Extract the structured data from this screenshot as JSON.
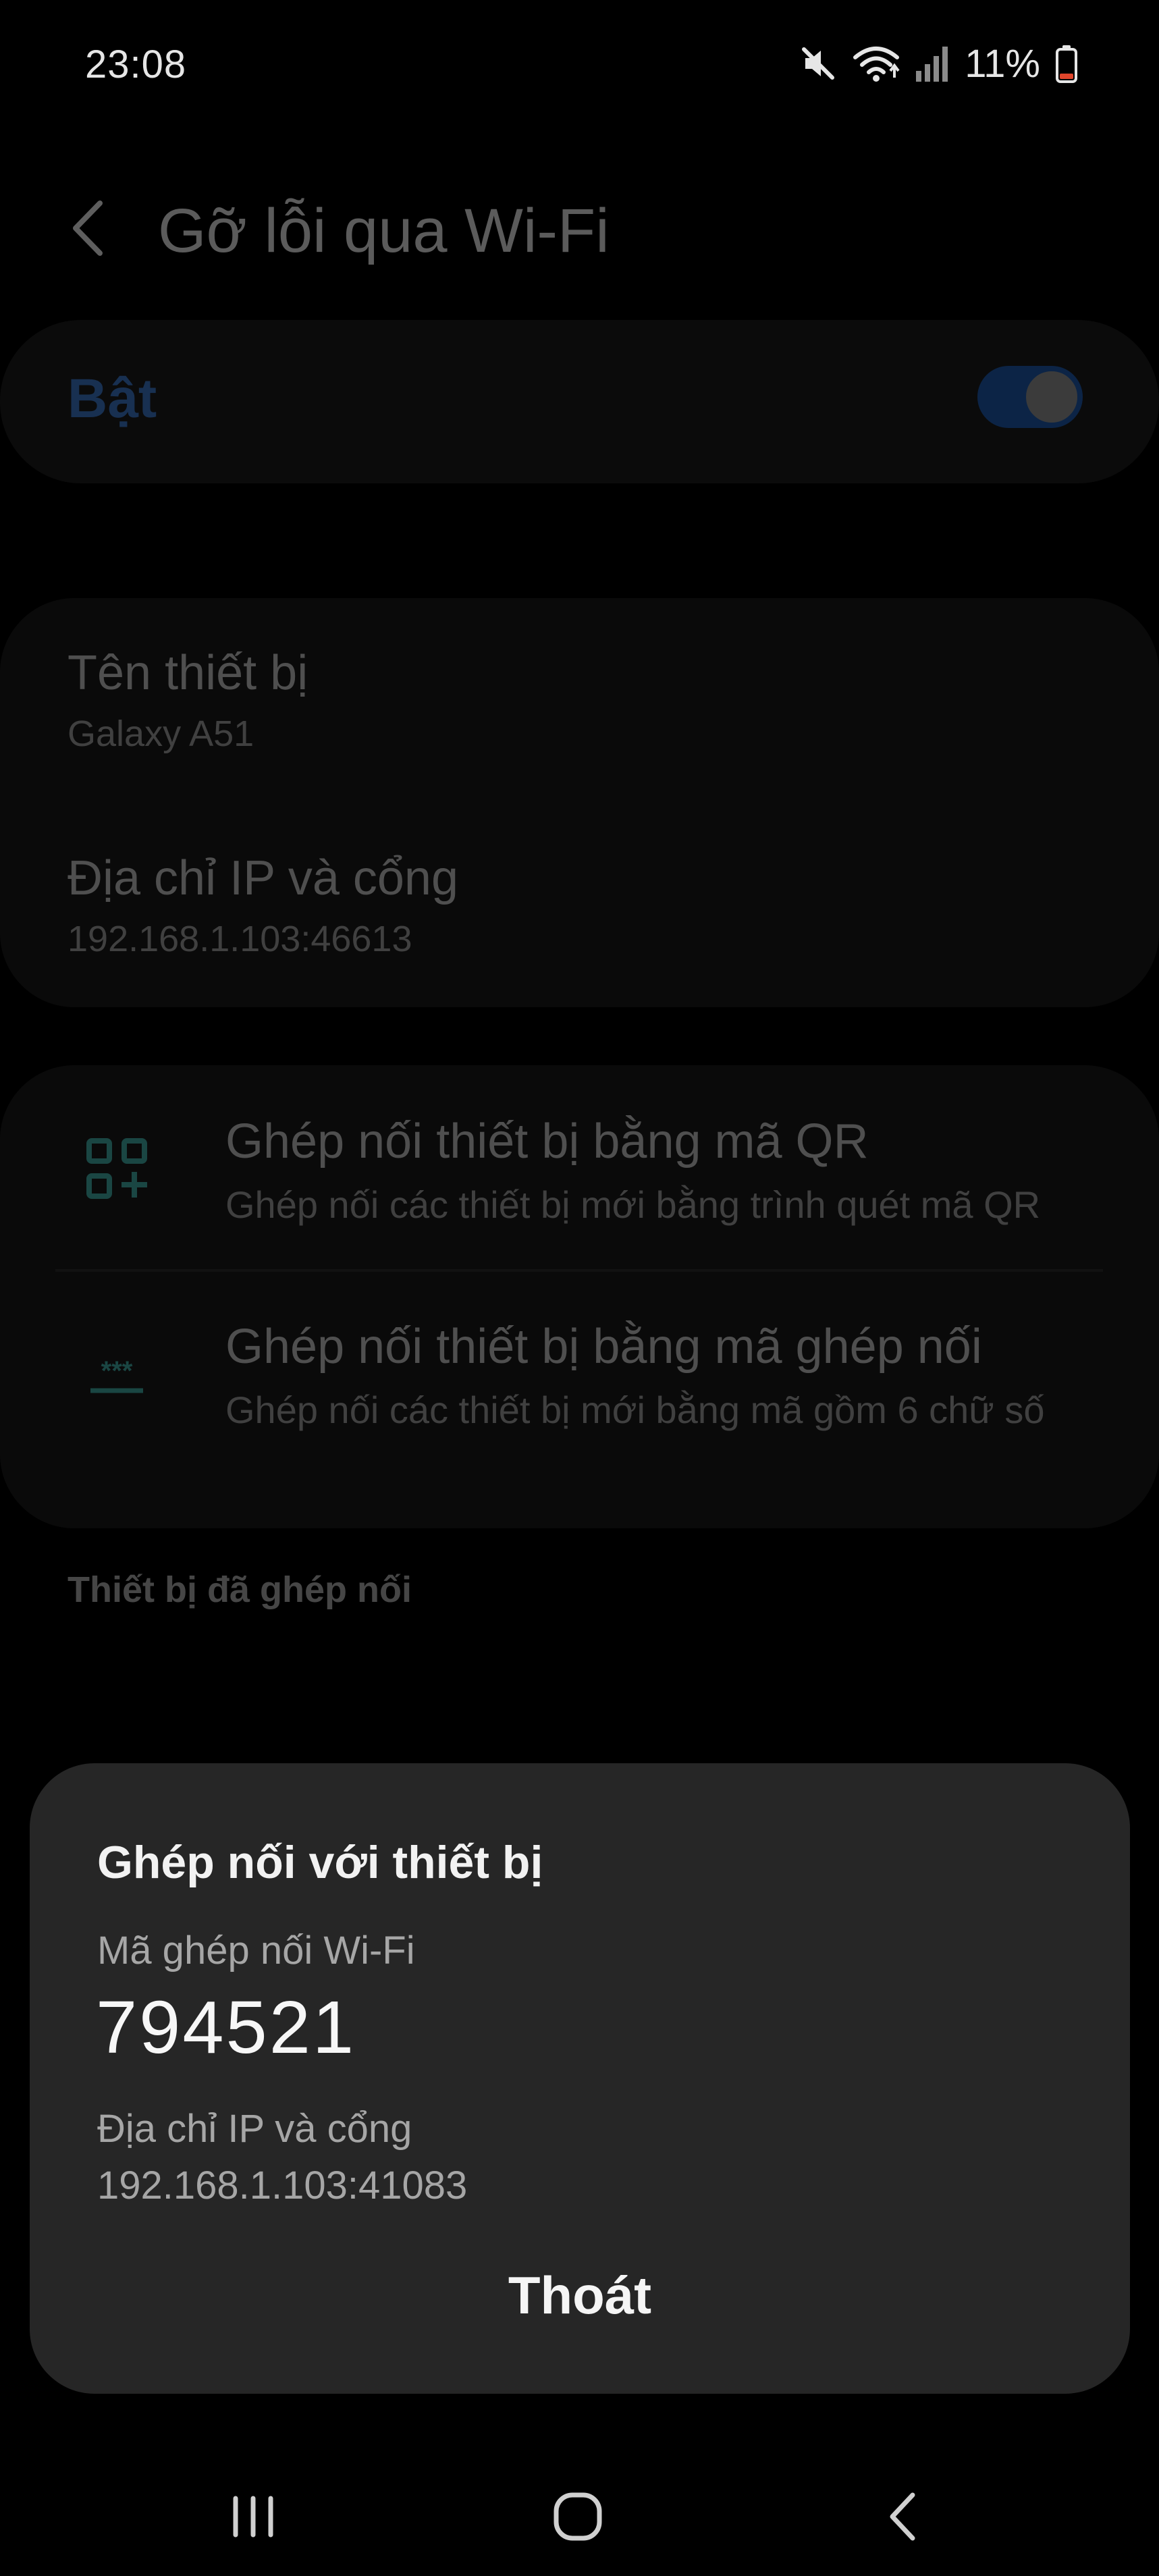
{
  "status_bar": {
    "time": "23:08",
    "battery_percent": "11%",
    "icons": [
      "mute-icon",
      "wifi-icon",
      "signal-icon",
      "battery-icon"
    ],
    "battery_color": "#e0452b"
  },
  "header": {
    "title": "Gỡ lỗi qua Wi-Fi",
    "back_icon": "back-arrow-icon"
  },
  "master_toggle": {
    "label": "Bật",
    "state": true,
    "accent_color": "#3a73c2"
  },
  "device_info": {
    "device_name_label": "Tên thiết bị",
    "device_name_value": "Galaxy A51",
    "ip_label": "Địa chỉ IP và cổng",
    "ip_value": "192.168.1.103:46613"
  },
  "pair_options": [
    {
      "title": "Ghép nối thiết bị bằng mã QR",
      "subtitle": "Ghép nối các thiết bị mới bằng trình quét mã QR",
      "icon": "qr-code-icon"
    },
    {
      "title": "Ghép nối thiết bị bằng mã ghép nối",
      "subtitle": "Ghép nối các thiết bị mới bằng mã gồm 6 chữ số",
      "icon": "passcode-icon"
    }
  ],
  "paired_section": {
    "label": "Thiết bị đã ghép nối"
  },
  "dialog": {
    "title": "Ghép nối với thiết bị",
    "code_label": "Mã ghép nối Wi-Fi",
    "code": "794521",
    "ip_label": "Địa chỉ IP và cổng",
    "ip_value": "192.168.1.103:41083",
    "exit_label": "Thoát"
  },
  "nav_bar": {
    "items": [
      "recent-apps-icon",
      "home-icon",
      "back-icon"
    ]
  }
}
